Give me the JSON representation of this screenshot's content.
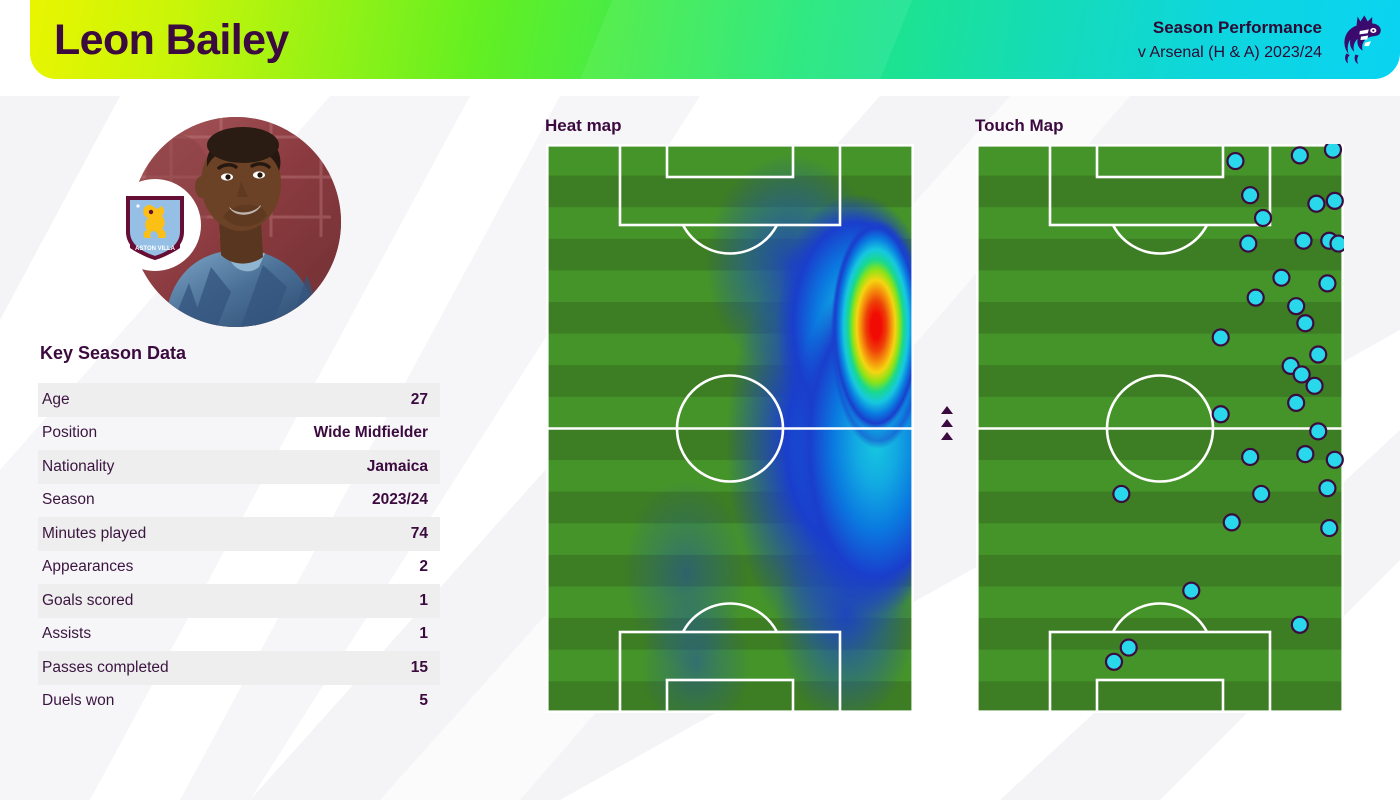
{
  "header": {
    "player_name": "Leon Bailey",
    "title": "Season Performance",
    "subtitle": "v Arsenal (H & A) 2023/24",
    "logo_icon": "premier-league-lion-icon",
    "gradient_start": "#e9f500",
    "gradient_end": "#0ad3f2",
    "text_color": "#3b0a3f"
  },
  "player": {
    "photo_alt": "Leon Bailey headshot",
    "club_badge_icon": "aston-villa-badge-icon",
    "badge_colors": {
      "shield": "#95bfe5",
      "claret": "#670e36",
      "lion": "#fbbf15"
    }
  },
  "key_data": {
    "title": "Key Season Data",
    "rows": [
      {
        "label": "Age",
        "value": "27"
      },
      {
        "label": "Position",
        "value": "Wide Midfielder"
      },
      {
        "label": "Nationality",
        "value": "Jamaica"
      },
      {
        "label": "Season",
        "value": "2023/24"
      },
      {
        "label": "Minutes played",
        "value": "74"
      },
      {
        "label": "Appearances",
        "value": "2"
      },
      {
        "label": "Goals scored",
        "value": "1"
      },
      {
        "label": "Assists",
        "value": "1"
      },
      {
        "label": "Passes completed",
        "value": "15"
      },
      {
        "label": "Duels won",
        "value": "5"
      }
    ]
  },
  "heat_map": {
    "title": "Heat map",
    "direction_icon": "up-arrow-icon",
    "direction_arrow_count": 3
  },
  "touch_map": {
    "title": "Touch Map",
    "dot_color": "#2ad8ec",
    "dot_stroke": "#3b0a3f",
    "dot_radius": 8
  },
  "chart_data": [
    {
      "type": "heatmap",
      "title": "Heat map",
      "xlabel": "",
      "ylabel": "",
      "orientation": "vertical-pitch-attacking-up",
      "pitch": {
        "width": 100,
        "height": 100,
        "grass_light": "#459429",
        "grass_dark": "#3d7d24",
        "stripes": 18
      },
      "colorscale": [
        "transparent",
        "#1a3ecc",
        "#0a7ae0",
        "#16c8e0",
        "#19d98c",
        "#4ee024",
        "#c3e817",
        "#f5d511",
        "#f58b0c",
        "#ee4208",
        "#f20b05"
      ],
      "hotspots": [
        {
          "x": 87,
          "y": 30,
          "intensity": 1.0,
          "radius": 16
        },
        {
          "x": 82,
          "y": 22,
          "intensity": 0.62,
          "radius": 20
        },
        {
          "x": 80,
          "y": 55,
          "intensity": 0.45,
          "radius": 18
        },
        {
          "x": 76,
          "y": 72,
          "intensity": 0.3,
          "radius": 16
        },
        {
          "x": 45,
          "y": 82,
          "intensity": 0.16,
          "radius": 14
        },
        {
          "x": 42,
          "y": 92,
          "intensity": 0.12,
          "radius": 12
        },
        {
          "x": 66,
          "y": 12,
          "intensity": 0.3,
          "radius": 14
        }
      ]
    },
    {
      "type": "scatter",
      "title": "Touch Map",
      "xlabel": "",
      "ylabel": "",
      "orientation": "vertical-pitch-attacking-up",
      "xlim": [
        0,
        100
      ],
      "ylim": [
        0,
        100
      ],
      "series": [
        {
          "name": "Touches",
          "count": 36,
          "points": [
            {
              "x": 70.5,
              "y": 3.0
            },
            {
              "x": 88.0,
              "y": 2.0
            },
            {
              "x": 97.0,
              "y": 1.0
            },
            {
              "x": 74.5,
              "y": 9.0
            },
            {
              "x": 78.0,
              "y": 13.0
            },
            {
              "x": 74.0,
              "y": 17.5
            },
            {
              "x": 92.5,
              "y": 10.5
            },
            {
              "x": 97.5,
              "y": 10.0
            },
            {
              "x": 89.0,
              "y": 17.0
            },
            {
              "x": 96.0,
              "y": 17.0
            },
            {
              "x": 98.5,
              "y": 17.5
            },
            {
              "x": 83.0,
              "y": 23.5
            },
            {
              "x": 95.5,
              "y": 24.5
            },
            {
              "x": 76.0,
              "y": 27.0
            },
            {
              "x": 87.0,
              "y": 28.5
            },
            {
              "x": 89.5,
              "y": 31.5
            },
            {
              "x": 66.5,
              "y": 34.0
            },
            {
              "x": 93.0,
              "y": 37.0
            },
            {
              "x": 85.5,
              "y": 39.0
            },
            {
              "x": 88.5,
              "y": 40.5
            },
            {
              "x": 92.0,
              "y": 42.5
            },
            {
              "x": 87.0,
              "y": 45.5
            },
            {
              "x": 66.5,
              "y": 47.5
            },
            {
              "x": 93.0,
              "y": 50.5
            },
            {
              "x": 74.5,
              "y": 55.0
            },
            {
              "x": 89.5,
              "y": 54.5
            },
            {
              "x": 97.5,
              "y": 55.5
            },
            {
              "x": 39.5,
              "y": 61.5
            },
            {
              "x": 77.5,
              "y": 61.5
            },
            {
              "x": 95.5,
              "y": 60.5
            },
            {
              "x": 69.5,
              "y": 66.5
            },
            {
              "x": 96.0,
              "y": 67.5
            },
            {
              "x": 58.5,
              "y": 78.5
            },
            {
              "x": 88.0,
              "y": 84.5
            },
            {
              "x": 37.5,
              "y": 91.0
            },
            {
              "x": 41.5,
              "y": 88.5
            }
          ]
        }
      ]
    }
  ]
}
